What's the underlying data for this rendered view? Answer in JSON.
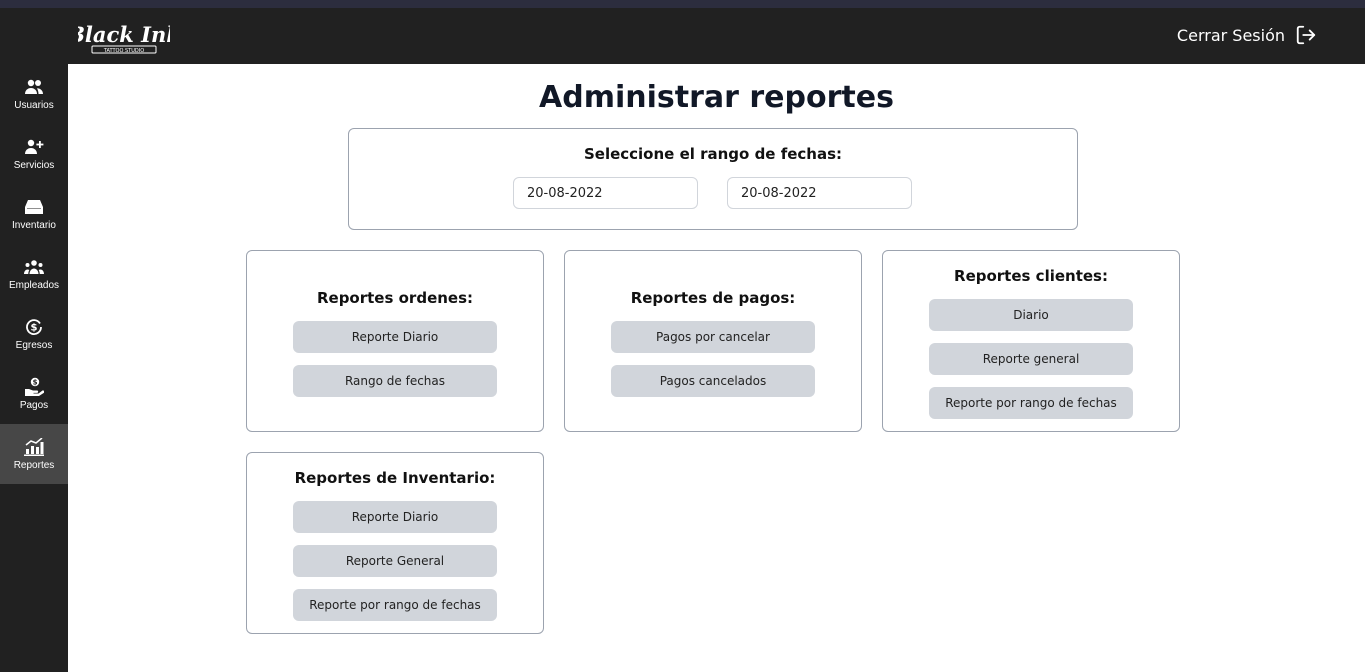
{
  "header": {
    "logo": {
      "main_text": "Black Ink",
      "sub_text": "TATTOO STUDIO"
    },
    "logout_label": "Cerrar Sesión"
  },
  "sidebar": {
    "items": [
      {
        "label": "Usuarios",
        "icon": "users-icon"
      },
      {
        "label": "Servicios",
        "icon": "user-plus-icon"
      },
      {
        "label": "Inventario",
        "icon": "inbox-icon"
      },
      {
        "label": "Empleados",
        "icon": "team-icon"
      },
      {
        "label": "Egresos",
        "icon": "dollar-circle-icon"
      },
      {
        "label": "Pagos",
        "icon": "hand-coin-icon"
      },
      {
        "label": "Reportes",
        "icon": "bar-chart-icon",
        "active": true
      }
    ]
  },
  "main": {
    "title": "Administrar reportes",
    "date_range": {
      "title": "Seleccione el rango de fechas:",
      "start_value": "20-08-2022",
      "end_value": "20-08-2022"
    },
    "cards": {
      "ordenes": {
        "title": "Reportes ordenes:",
        "buttons": [
          "Reporte Diario",
          "Rango de fechas"
        ]
      },
      "pagos": {
        "title": "Reportes de pagos:",
        "buttons": [
          "Pagos por cancelar",
          "Pagos cancelados"
        ]
      },
      "clientes": {
        "title": "Reportes clientes:",
        "buttons": [
          "Diario",
          "Reporte general",
          "Reporte por rango de fechas"
        ]
      },
      "inventario": {
        "title": "Reportes de Inventario:",
        "buttons": [
          "Reporte Diario",
          "Reporte General",
          "Reporte por rango de fechas"
        ]
      }
    }
  },
  "colors": {
    "header_bg": "#212121",
    "sidebar_active": "#474747",
    "button_bg": "#d1d5db",
    "border": "#9ca3af"
  }
}
